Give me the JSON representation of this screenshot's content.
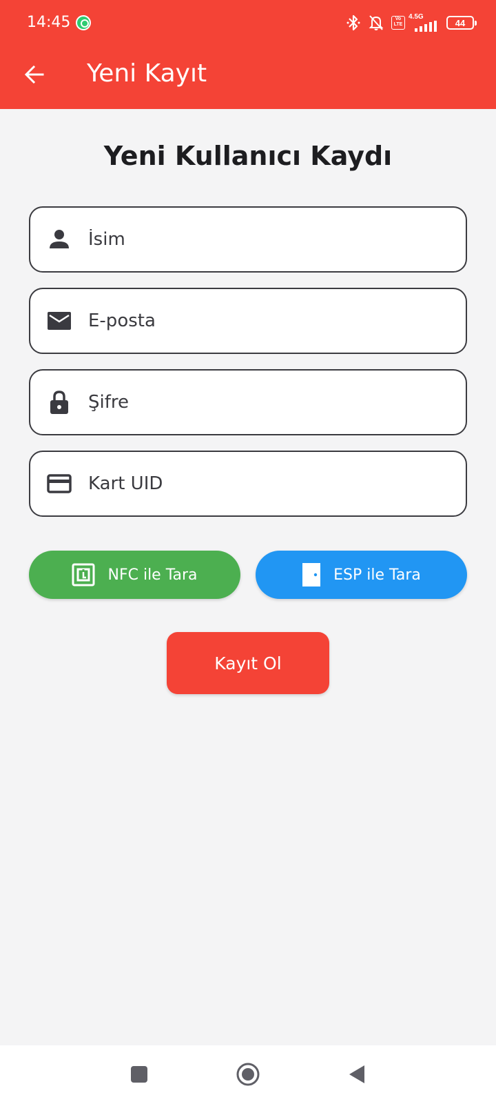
{
  "status_bar": {
    "time": "14:45",
    "network_label": "4.5G",
    "volte_label": "Vo LTE",
    "battery": "44",
    "icons": [
      "whatsapp-icon",
      "bluetooth-icon",
      "bell-off-icon",
      "volte-icon",
      "signal-icon",
      "battery-icon"
    ]
  },
  "app_bar": {
    "title": "Yeni Kayıt",
    "back_icon": "arrow-left-icon"
  },
  "form": {
    "heading": "Yeni Kullanıcı Kaydı",
    "fields": [
      {
        "icon": "person-icon",
        "placeholder": "İsim",
        "value": ""
      },
      {
        "icon": "mail-icon",
        "placeholder": "E-posta",
        "value": ""
      },
      {
        "icon": "lock-icon",
        "placeholder": "Şifre",
        "value": ""
      },
      {
        "icon": "card-icon",
        "placeholder": "Kart UID",
        "value": ""
      }
    ],
    "scan_buttons": [
      {
        "label": "NFC ile Tara",
        "icon": "nfc-icon",
        "color": "#4caf50"
      },
      {
        "label": "ESP ile Tara",
        "icon": "door-icon",
        "color": "#2196f3"
      }
    ],
    "submit_label": "Kayıt Ol"
  },
  "colors": {
    "primary": "#f44336",
    "background": "#f4f4f5",
    "nfc_button": "#4caf50",
    "esp_button": "#2196f3"
  },
  "nav_bar": {
    "buttons": [
      "recents-icon",
      "home-icon",
      "back-triangle-icon"
    ]
  }
}
